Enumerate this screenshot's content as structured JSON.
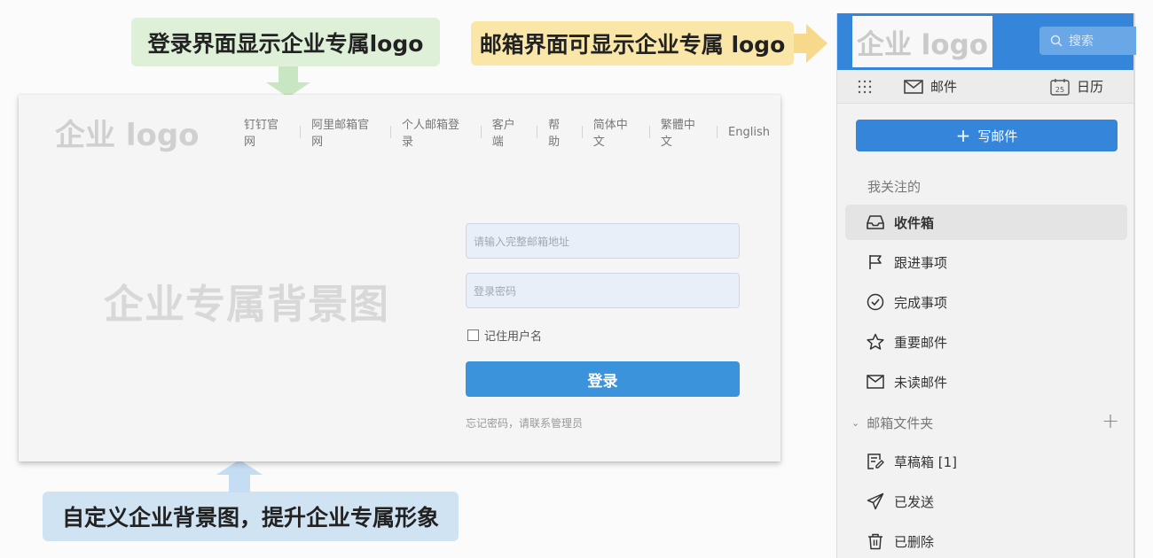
{
  "callouts": {
    "login_logo": "登录界面显示企业专属logo",
    "mail_logo": "邮箱界面可显示企业专属 logo",
    "background": "自定义企业背景图，提升企业专属形象"
  },
  "login_page": {
    "logo": "企业 logo",
    "nav": [
      "钉钉官网",
      "阿里邮箱官网",
      "个人邮箱登录",
      "客户端",
      "帮助",
      "简体中文",
      "繁體中文",
      "English"
    ],
    "background_text": "企业专属背景图",
    "email_placeholder": "请输入完整邮箱地址",
    "password_placeholder": "登录密码",
    "remember_label": "记住用户名",
    "remember_checked": false,
    "login_button": "登录",
    "forgot_text": "忘记密码，请联系管理员"
  },
  "mail_panel": {
    "logo": "企业 logo",
    "search_placeholder": "搜索",
    "tabs": {
      "mail": "邮件",
      "calendar": "日历",
      "calendar_day": "25"
    },
    "compose": "写邮件",
    "followed_title": "我关注的",
    "followed": [
      {
        "label": "收件箱",
        "icon": "inbox-icon",
        "active": true
      },
      {
        "label": "跟进事项",
        "icon": "flag-icon"
      },
      {
        "label": "完成事项",
        "icon": "check-circle-icon"
      },
      {
        "label": "重要邮件",
        "icon": "star-icon"
      },
      {
        "label": "未读邮件",
        "icon": "envelope-icon"
      }
    ],
    "folders_title": "邮箱文件夹",
    "folders": [
      {
        "label": "草稿箱 [1]",
        "icon": "draft-icon"
      },
      {
        "label": "已发送",
        "icon": "send-icon"
      },
      {
        "label": "已删除",
        "icon": "trash-icon"
      }
    ]
  },
  "colors": {
    "accent_blue": "#3586da",
    "login_button": "#3b93dc",
    "callout_green": "#dff0d8",
    "callout_yellow": "#fae7a8",
    "callout_blue": "#cfe3f3"
  }
}
